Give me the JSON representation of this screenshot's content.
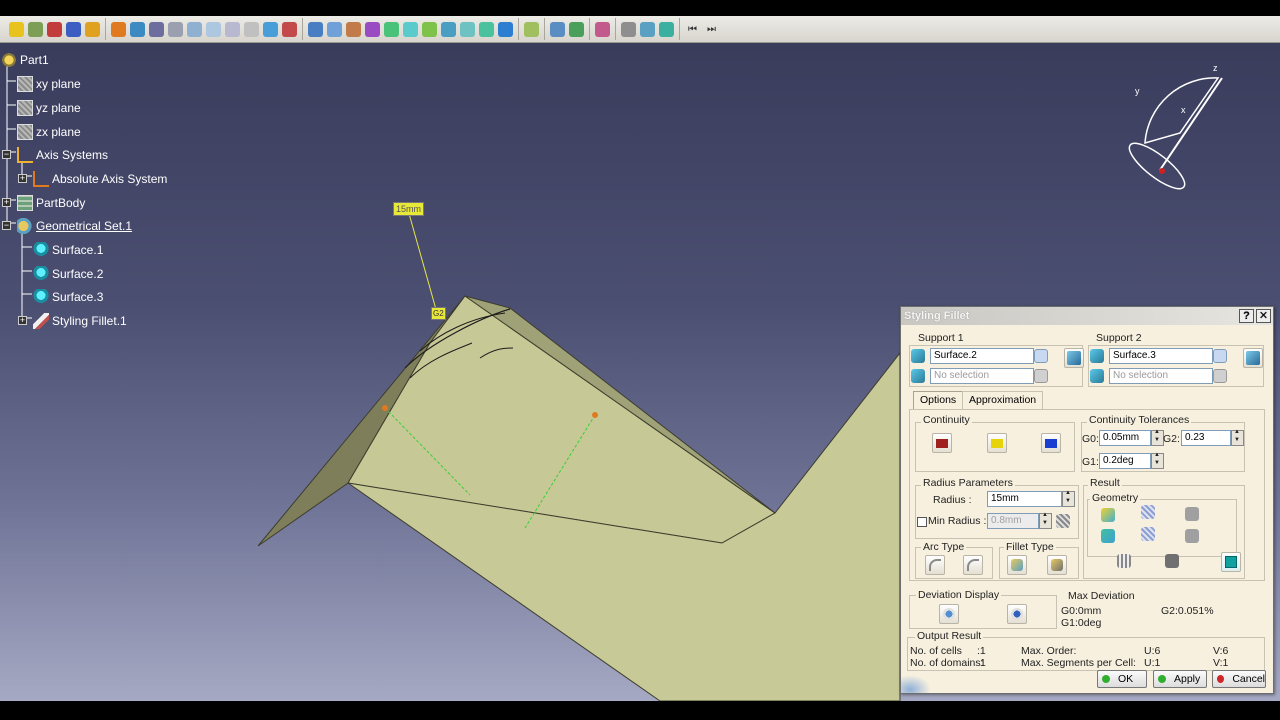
{
  "tree": {
    "items": [
      {
        "label": "Part1",
        "icon": "part-icon"
      },
      {
        "label": "xy plane",
        "icon": "plane-icon"
      },
      {
        "label": "yz plane",
        "icon": "plane-icon"
      },
      {
        "label": "zx plane",
        "icon": "plane-icon"
      },
      {
        "label": "Axis Systems",
        "icon": "axis-systems-icon"
      },
      {
        "label": "Absolute Axis System",
        "icon": "axis-icon"
      },
      {
        "label": "PartBody",
        "icon": "partbody-icon"
      },
      {
        "label": "Geometrical Set.1",
        "icon": "geometrical-set-icon"
      },
      {
        "label": "Surface.1",
        "icon": "surface-icon"
      },
      {
        "label": "Surface.2",
        "icon": "surface-icon"
      },
      {
        "label": "Surface.3",
        "icon": "surface-icon"
      },
      {
        "label": "Styling Fillet.1",
        "icon": "styling-fillet-icon"
      }
    ]
  },
  "viewport": {
    "radius_tag": "15mm",
    "g2_tag": "G2",
    "compass": {
      "x": "x",
      "y": "y",
      "z": "z"
    }
  },
  "dialog": {
    "title": "Styling Fillet",
    "help_label": "?",
    "close_label": "✕",
    "support1": {
      "label": "Support 1",
      "surface": "Surface.2",
      "curve_placeholder": "No selection"
    },
    "support2": {
      "label": "Support 2",
      "surface": "Surface.3",
      "curve_placeholder": "No selection"
    },
    "tabs": [
      "Options",
      "Approximation"
    ],
    "continuity": {
      "label": "Continuity",
      "options": [
        "G0",
        "G1",
        "G2"
      ]
    },
    "tolerances": {
      "label": "Continuity Tolerances",
      "g0_label": "G0:",
      "g0": "0.05mm",
      "g1_label": "G1:",
      "g1": "0.2deg",
      "g2_label": "G2:",
      "g2": "0.23"
    },
    "radius": {
      "label": "Radius Parameters",
      "radius_label": "Radius :",
      "radius_value": "15mm",
      "min_radius_label": "Min Radius :",
      "min_radius_value": "0.8mm"
    },
    "result": {
      "label": "Result",
      "geometry_label": "Geometry"
    },
    "arc_type": {
      "label": "Arc Type"
    },
    "fillet_type": {
      "label": "Fillet Type"
    },
    "deviation": {
      "label": "Deviation Display",
      "max_label": "Max Deviation",
      "g0": "G0:0mm",
      "g1": "G1:0deg",
      "g2": "G2:0.051%"
    },
    "output": {
      "label": "Output Result",
      "cells_label": "No. of cells",
      "cells_value": ":1",
      "domains_label": "No. of domains:",
      "domains_value": "1",
      "max_order_label": "Max. Order:",
      "max_order_u": "U:6",
      "max_order_v": "V:6",
      "max_seg_label": "Max. Segments per Cell:",
      "max_seg_u": "U:1",
      "max_seg_v": "V:1"
    },
    "buttons": {
      "ok": "OK",
      "apply": "Apply",
      "cancel": "Cancel"
    }
  },
  "colors": {
    "surface_fill": "#c7c996",
    "accent_g0": "#c0392b",
    "accent_g1": "#e6d30a",
    "accent_g2": "#1a3fd0"
  }
}
